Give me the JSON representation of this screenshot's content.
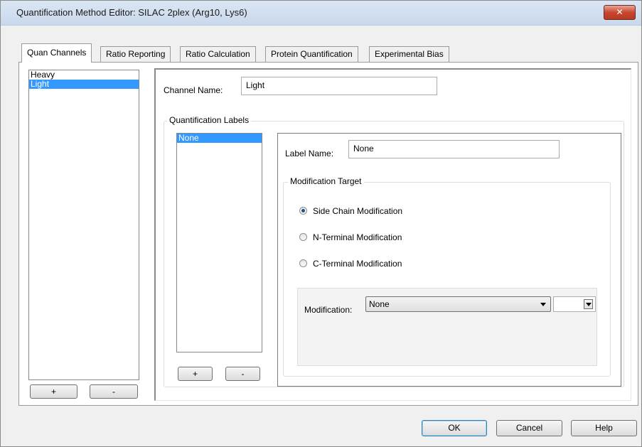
{
  "window": {
    "title": "Quantification Method Editor: SILAC 2plex (Arg10, Lys6)",
    "close_glyph": "✕"
  },
  "tabs": [
    {
      "label": "Quan Channels",
      "active": true
    },
    {
      "label": "Ratio Reporting",
      "active": false
    },
    {
      "label": "Ratio Calculation",
      "active": false
    },
    {
      "label": "Protein Quantification",
      "active": false
    },
    {
      "label": "Experimental Bias",
      "active": false
    }
  ],
  "channels": {
    "items": [
      "Heavy",
      "Light"
    ],
    "selected": "Light",
    "add_label": "+",
    "remove_label": "-"
  },
  "channel_name": {
    "label": "Channel Name:",
    "value": "Light"
  },
  "quant_labels": {
    "group_title": "Quantification Labels",
    "items": [
      "None"
    ],
    "selected": "None",
    "add_label": "+",
    "remove_label": "-"
  },
  "label_name": {
    "label": "Label Name:",
    "value": "None"
  },
  "modification_target": {
    "group_title": "Modification Target",
    "options": [
      {
        "label": "Side Chain Modification",
        "checked": true
      },
      {
        "label": "N-Terminal Modification",
        "checked": false
      },
      {
        "label": "C-Terminal Modification",
        "checked": false
      }
    ]
  },
  "modification": {
    "label": "Modification:",
    "selected": "None"
  },
  "footer": {
    "ok_label": "OK",
    "cancel_label": "Cancel",
    "help_label": "Help"
  }
}
